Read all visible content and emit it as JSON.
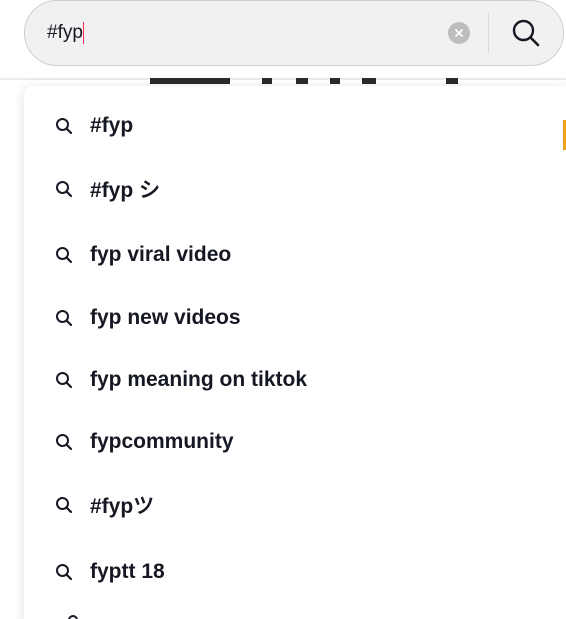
{
  "search": {
    "value": "#fyp",
    "caret_color": "#fe2c55"
  },
  "icons": {
    "clear": "clear-x-icon",
    "search": "magnifier-icon",
    "suggestion": "magnifier-small-icon"
  },
  "colors": {
    "text": "#161823",
    "bar_bg": "#f1f1f2",
    "accent": "#fe2c55"
  },
  "suggestions": [
    {
      "label": "#fyp"
    },
    {
      "label": "#fyp シ"
    },
    {
      "label": "fyp viral video"
    },
    {
      "label": "fyp new videos"
    },
    {
      "label": "fyp meaning on tiktok"
    },
    {
      "label": "fypcommunity"
    },
    {
      "label": "#fypツ"
    },
    {
      "label": "fyptt 18"
    }
  ]
}
